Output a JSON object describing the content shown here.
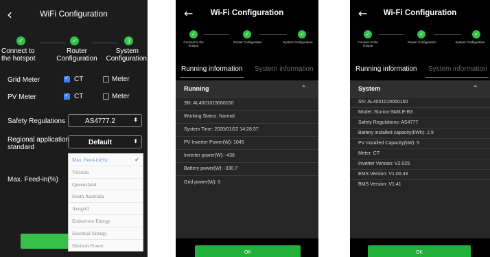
{
  "screen1": {
    "title": "WiFi Configuration",
    "back": "‹",
    "steps": [
      {
        "line1": "Connect to",
        "line2": "the hotspot",
        "state": "done"
      },
      {
        "line1": "Router",
        "line2": "Configuration",
        "state": "done"
      },
      {
        "line1": "System",
        "line2": "Configuration",
        "state": "current",
        "number": "3"
      }
    ],
    "grid_meter": {
      "label": "Grid Meter",
      "ct": "CT",
      "ct_checked": true,
      "meter": "Meter",
      "meter_checked": false
    },
    "pv_meter": {
      "label": "PV Meter",
      "ct": "CT",
      "ct_checked": true,
      "meter": "Meter",
      "meter_checked": false
    },
    "safety": {
      "label": "Safety Regulations",
      "value": "AS4777.2"
    },
    "regional": {
      "label_line1": "Regional application",
      "label_line2": "standard",
      "value": "Default"
    },
    "max_feed": {
      "label": "Max. Feed-in(%)"
    },
    "dropdown_options": [
      {
        "label": "Max. Feed-in(%)",
        "selected": true
      },
      {
        "label": "Victoria",
        "selected": false
      },
      {
        "label": "Queensland",
        "selected": false
      },
      {
        "label": "South Australia",
        "selected": false
      },
      {
        "label": "Ausgrid",
        "selected": false
      },
      {
        "label": "Endeavour Energy",
        "selected": false
      },
      {
        "label": "Essential Energy",
        "selected": false
      },
      {
        "label": "Horizon Power",
        "selected": false
      }
    ]
  },
  "screen2": {
    "title": "Wi-Fi Configuration",
    "back": "←",
    "steps": [
      {
        "line1": "Connect to the",
        "line2": "hotspot"
      },
      {
        "line1": "Router Configuration",
        "line2": ""
      },
      {
        "line1": "System Configuration",
        "line2": ""
      }
    ],
    "tabs": [
      "Running information",
      "System information"
    ],
    "section": "Running",
    "rows": [
      "SN: AL4001019060160",
      "Working Status: Normal",
      "System Time: 2020/01/22 14:28:37",
      "PV Inverter Power(W): 1045",
      "Inverter power(W): -438",
      "Battery power(W): -330.7",
      "Grid power(W): 0"
    ],
    "ok": "OK"
  },
  "screen3": {
    "title": "Wi-Fi Configuration",
    "back": "←",
    "steps": [
      {
        "line1": "Connect to the",
        "line2": "hotspot"
      },
      {
        "line1": "Router Configuration",
        "line2": ""
      },
      {
        "line1": "System Configuration",
        "line2": ""
      }
    ],
    "tabs": [
      "Running information",
      "System information"
    ],
    "section": "System",
    "rows": [
      "SN: AL4001019060160",
      "Model: Storion-SMILE-B3",
      "Safety Regulations: AS4777",
      "Battery installed capacity(kWh): 2.9",
      "PV Installed Capacity(kW): 5",
      "Meter: CT",
      "Inverter Version: V2.025",
      "EMS Version: V1.00.43",
      "BMS Version: V1.41"
    ],
    "ok": "OK"
  },
  "colors": {
    "accent_green": "#35c24a",
    "checkbox_blue": "#3b82f6",
    "background": "#000000"
  },
  "icons": {
    "back": "back-arrow-icon",
    "check": "check-icon",
    "collapse": "chevron-up-icon",
    "dropdown": "updown-arrow-icon"
  }
}
